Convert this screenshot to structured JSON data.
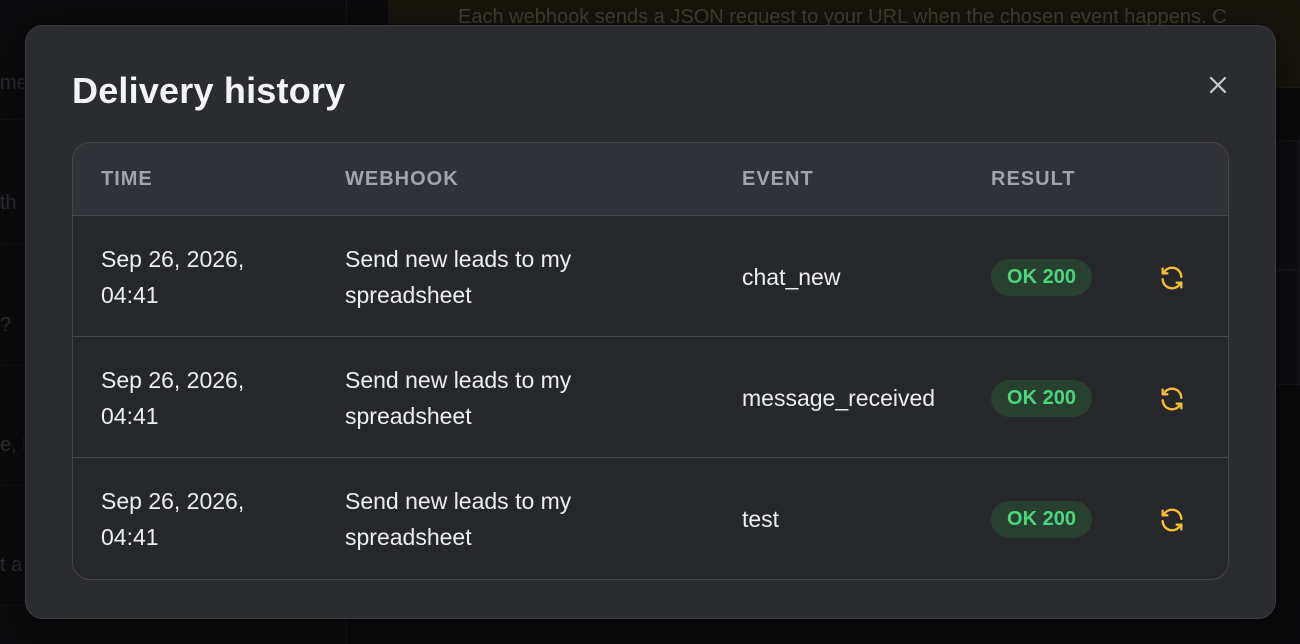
{
  "background": {
    "banner_text": "Each webhook sends a JSON request to your URL when the chosen event happens. C",
    "sidebar_fragments": [
      "me",
      "th",
      "?",
      "e, l",
      "t a"
    ]
  },
  "modal": {
    "title": "Delivery history",
    "close_icon": "close-icon",
    "columns": {
      "time": "TIME",
      "webhook": "WEBHOOK",
      "event": "EVENT",
      "result": "RESULT"
    },
    "rows": [
      {
        "time_date": "Sep 26, 2026,",
        "time_clock": "04:41",
        "webhook_line1": "Send new leads to my",
        "webhook_line2": "spreadsheet",
        "event": "chat_new",
        "result": "OK 200",
        "action_icon": "retry-icon"
      },
      {
        "time_date": "Sep 26, 2026,",
        "time_clock": "04:41",
        "webhook_line1": "Send new leads to my",
        "webhook_line2": "spreadsheet",
        "event": "message_received",
        "result": "OK 200",
        "action_icon": "retry-icon"
      },
      {
        "time_date": "Sep 26, 2026,",
        "time_clock": "04:41",
        "webhook_line1": "Send new leads to my",
        "webhook_line2": "spreadsheet",
        "event": "test",
        "result": "OK 200",
        "action_icon": "retry-icon"
      }
    ]
  },
  "colors": {
    "success_text": "#4ad67b",
    "success_bg": "#28402f",
    "retry_icon": "#f2c12e",
    "modal_bg": "#2b2c30"
  }
}
